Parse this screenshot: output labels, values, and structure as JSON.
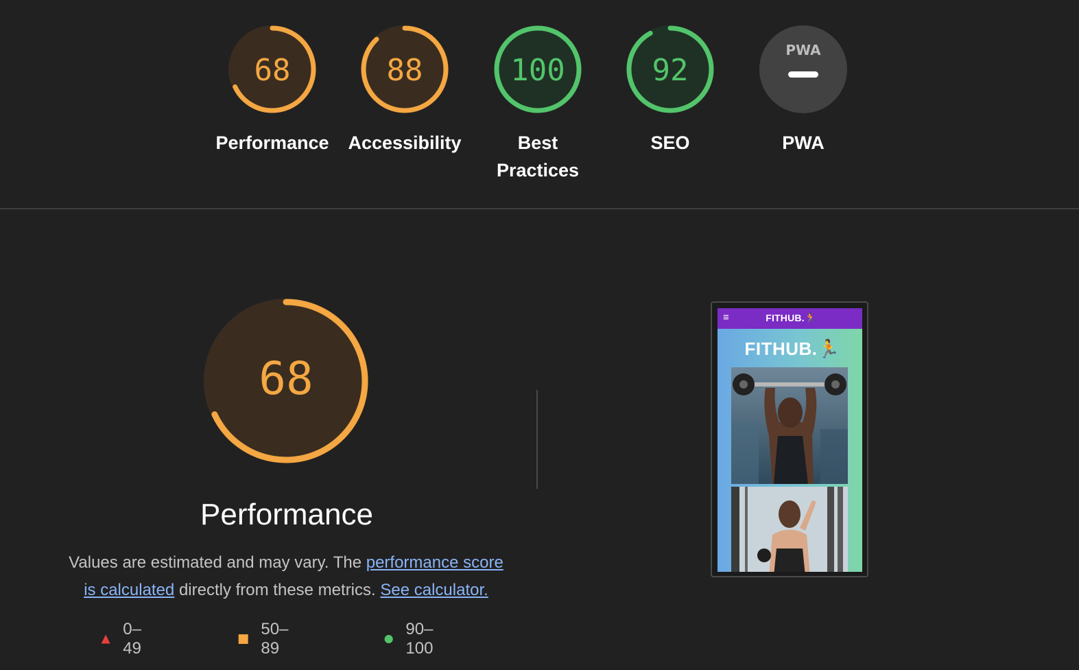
{
  "colors": {
    "average": "#f4a742",
    "average_bg": "#3a2d20",
    "pass": "#53c46b",
    "pass_bg": "#1f3124",
    "fail": "#e83f3b",
    "na_bg": "#424242",
    "link": "#8ab4f8"
  },
  "categories": [
    {
      "label": "Performance",
      "score": "68",
      "value": 68,
      "rating": "average"
    },
    {
      "label": "Accessibility",
      "score": "88",
      "value": 88,
      "rating": "average"
    },
    {
      "label": "Best Practices",
      "score": "100",
      "value": 100,
      "rating": "pass"
    },
    {
      "label": "SEO",
      "score": "92",
      "value": 92,
      "rating": "pass"
    },
    {
      "label": "PWA",
      "score": "",
      "value": null,
      "rating": "na",
      "icon_text": "PWA"
    }
  ],
  "performance": {
    "score": "68",
    "value": 68,
    "title": "Performance",
    "desc_prefix": "Values are estimated and may vary. The ",
    "link1": "performance score is calculated",
    "desc_middle": " directly from these metrics. ",
    "link2": "See calculator."
  },
  "legend": [
    {
      "range": "0–49",
      "shape": "triangle",
      "color": "#e83f3b"
    },
    {
      "range": "50–89",
      "shape": "square",
      "color": "#f4a742"
    },
    {
      "range": "90–100",
      "shape": "circle",
      "color": "#53c46b"
    }
  ],
  "screenshot": {
    "nav_menu": "≡",
    "nav_brand": "FITHUB.",
    "hero_title": "FITHUB.",
    "runner_icon": "running-person-icon"
  }
}
